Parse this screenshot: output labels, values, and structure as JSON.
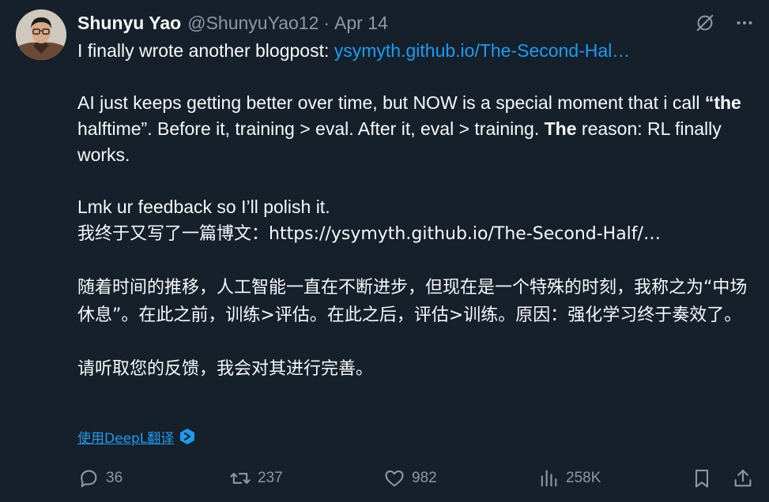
{
  "author": {
    "name": "Shunyu Yao",
    "handle": "@ShunyuYao12",
    "separator": "·",
    "date": "Apr 14"
  },
  "tweet": {
    "line1_prefix": "I finally wrote another blogpost: ",
    "line1_link": "ysymyth.github.io/The-Second-Hal…",
    "p2_a": "AI just keeps getting better over time, but NOW is a special moment that i call ",
    "p2_b": "“the",
    "p2_c": " halftime”. Before it, training > eval. After it, eval > training. ",
    "p2_d": "The",
    "p2_e": " reason: RL finally works.",
    "p3": "Lmk ur feedback so I’ll polish it."
  },
  "translation_text": {
    "zh1": "我终于又写了一篇博文：https://ysymyth.github.io/The-Second-Half/…",
    "zh2": "随着时间的推移，人工智能一直在不断进步，但现在是一个特殊的时刻，我称之为“中场休息”。在此之前，训练>评估。在此之后，评估>训练。原因：强化学习终于奏效了。",
    "zh3": "请听取您的反馈，我会对其进行完善。"
  },
  "translate_link": "使用DeepL翻译",
  "actions": {
    "replies": "36",
    "retweets": "237",
    "likes": "982",
    "views": "258K"
  },
  "icons": {
    "top": [
      "grok-slash-icon",
      "more-icon"
    ],
    "bottom": [
      "reply-icon",
      "retweet-icon",
      "like-icon",
      "views-icon",
      "bookmark-icon",
      "share-icon"
    ],
    "translate": "deepl-icon"
  },
  "colors": {
    "background": "#15202b",
    "text": "#f7f9f9",
    "muted": "#8b98a5",
    "link": "#1d9bf0"
  }
}
